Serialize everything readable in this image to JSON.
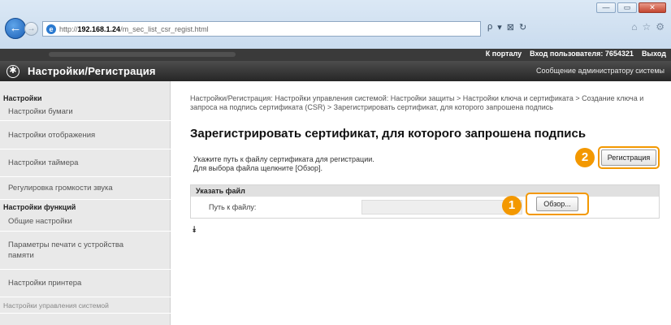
{
  "browser": {
    "url_prefix": "http://",
    "url_host": "192.168.1.24",
    "url_path": "/m_sec_list_csr_regist.html",
    "window_controls": [
      "—",
      "▭",
      "✕"
    ],
    "addr_tools": [
      "ρ",
      "▾",
      "⊠",
      "↻"
    ],
    "right_tools": [
      "⌂",
      "☆",
      "⚙"
    ]
  },
  "topbar": {
    "portal_link": "К порталу",
    "login_text": "Вход пользователя: 7654321",
    "logout_link": "Выход"
  },
  "header": {
    "title": "Настройки/Регистрация",
    "admin_message": "Сообщение администратору системы"
  },
  "sidebar": {
    "section1": "Настройки",
    "items1": [
      "Настройки бумаги",
      "Настройки отображения",
      "Настройки таймера",
      "Регулировка громкости звука"
    ],
    "section2": "Настройки функций",
    "items2": [
      "Общие настройки",
      "Параметры печати с устройства памяти",
      "Настройки принтера"
    ],
    "items3": [
      "Настройки управления системой"
    ]
  },
  "main": {
    "breadcrumb": "Настройки/Регистрация: Настройки управления системой: Настройки защиты > Настройки ключа и сертификата > Создание ключа и запроса на подпись сертификата (CSR) > Зарегистрировать сертификат, для которого запрошена подпись",
    "page_title": "Зарегистрировать сертификат, для которого запрошена подпись",
    "instruction_line1": "Укажите путь к файлу сертификата для регистрации.",
    "instruction_line2": "Для выбора файла щелкните [Обзор].",
    "register_button": "Регистрация",
    "section_title": "Указать файл",
    "file_path_label": "Путь к файлу:",
    "file_path_value": "",
    "browse_button": "Обзор...",
    "callout_1": "1",
    "callout_2": "2",
    "scroll_top_icon": "⯯"
  },
  "colors": {
    "accent": "#f39800",
    "header_bg": "#262626",
    "sidebar_bg": "#e9e9e9"
  }
}
